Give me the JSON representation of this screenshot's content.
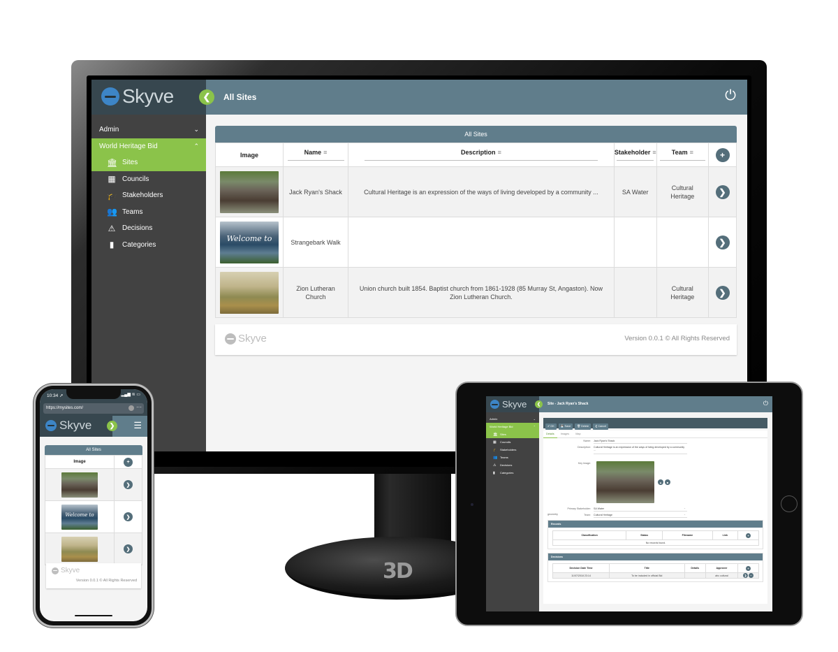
{
  "brand": {
    "name": "Skyve",
    "primary_color": "#607d8b",
    "sidebar_color": "#424242",
    "accent_green": "#8bc34a",
    "logo_blue": "#3d85c6"
  },
  "desktop": {
    "header": {
      "title": "All Sites",
      "toggle_icon": "chevron-left",
      "power_icon": "power"
    },
    "sidebar": {
      "groups": [
        {
          "label": "Admin",
          "expanded": false
        },
        {
          "label": "World Heritage Bid",
          "expanded": true
        }
      ],
      "items": [
        {
          "label": "Sites",
          "icon": "bank-building",
          "active": true
        },
        {
          "label": "Councils",
          "icon": "office-building"
        },
        {
          "label": "Stakeholders",
          "icon": "graduation-cap"
        },
        {
          "label": "Teams",
          "icon": "users"
        },
        {
          "label": "Decisions",
          "icon": "warning-triangle"
        },
        {
          "label": "Categories",
          "icon": "bookmark"
        }
      ]
    },
    "grid": {
      "title": "All Sites",
      "columns": [
        "Image",
        "Name",
        "Description",
        "Stakeholder",
        "Team"
      ],
      "add_icon": "plus-circle",
      "rows": [
        {
          "image": "Old wooden shack",
          "name": "Jack Ryan's Shack",
          "description": "Cultural Heritage is an expression of the ways of living developed by a community ...",
          "stakeholder": "SA Water",
          "team": "Cultural Heritage"
        },
        {
          "image": "Welcome to",
          "name": "Strangebark Walk",
          "description": "",
          "stakeholder": "",
          "team": ""
        },
        {
          "image": "Landscape painting",
          "name": "Zion Lutheran Church",
          "description": "Union church built 1854. Baptist church from 1861-1928 (85 Murray St, Angaston). Now Zion Lutheran Church.",
          "stakeholder": "",
          "team": "Cultural Heritage"
        }
      ]
    },
    "footer": {
      "logo": "Skyve",
      "version_text": "Version 0.0.1",
      "copyright_symbol": "©",
      "rights": "All Rights Reserved"
    }
  },
  "phone": {
    "status": {
      "time": "10:34 ➚",
      "indicators": "▂▄▆ ≋ ▭"
    },
    "browser": {
      "url": "https://mysites.com/",
      "more": "···"
    },
    "header": {
      "toggle_icon": "chevron-right",
      "menu_icon": "hamburger"
    },
    "grid": {
      "title": "All Sites",
      "column": "Image",
      "rows": [
        "Old wooden shack",
        "Welcome to",
        "Landscape painting"
      ]
    },
    "footer": {
      "logo": "Skyve",
      "version_text": "Version 0.0.1",
      "copyright_symbol": "©",
      "rights": "All Rights Reserved"
    }
  },
  "tablet": {
    "header": {
      "title": "Site - Jack Ryan's Shack"
    },
    "sidebar": {
      "groups": [
        "Admin",
        "World Heritage Bid"
      ],
      "items": [
        "Sites",
        "Councils",
        "Stakeholders",
        "Teams",
        "Decisions",
        "Categories"
      ]
    },
    "toolbar": {
      "ok": "OK",
      "save": "Save",
      "delete": "Delete",
      "cancel": "Cancel"
    },
    "tabs": [
      "Details",
      "Images",
      "Map"
    ],
    "form": {
      "name_label": "Name:",
      "name_value": "Jack Ryan's Shack",
      "description_label": "Description:",
      "description_value": "Cultural Heritage is an expression of the ways of living developed by a community ...",
      "key_image_label": "Key Image:",
      "stakeholder_label": "Primary Stakeholder:",
      "stakeholder_value": "SA Water",
      "team_label": "Team:",
      "team_value": "Cultural Heritage",
      "geometry_label": "geometry"
    },
    "records": {
      "title": "Records",
      "columns": [
        "Classification",
        "Status",
        "Filename",
        "Link"
      ],
      "empty_message": "No records found."
    },
    "decisions": {
      "title": "Decisions",
      "columns": [
        "Decision Date Time",
        "Title",
        "Details",
        "Approver"
      ],
      "rows": [
        {
          "date": "11/07/2018 23:14",
          "title": "To be included in official Bid",
          "details": "",
          "approver": "ahc cultural"
        }
      ]
    }
  }
}
